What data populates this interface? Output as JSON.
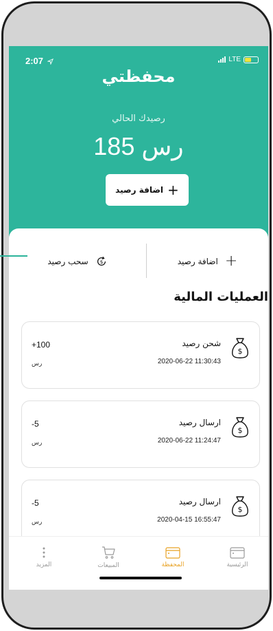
{
  "status": {
    "time": "2:07",
    "network": "LTE"
  },
  "header": {
    "title": "محفظتي",
    "balance_label": "رصيدك الحالي",
    "balance_amount": "185 رس",
    "add_button": "اضافة رصيد"
  },
  "actions": {
    "add": "اضافة رصيد",
    "withdraw": "سحب رصيد"
  },
  "section_title": "العمليات المالية",
  "transactions": [
    {
      "title": "شحن رصيد",
      "date": "2020-06-22 11:30:43",
      "amount": "+100",
      "currency": "رس"
    },
    {
      "title": "ارسال رصيد",
      "date": "2020-06-22 11:24:47",
      "amount": "-5",
      "currency": "رس"
    },
    {
      "title": "ارسال رصيد",
      "date": "2020-04-15 16:55:47",
      "amount": "-5",
      "currency": "رس"
    }
  ],
  "tabs": [
    {
      "label": "الرئيسية",
      "icon": "wallet-icon"
    },
    {
      "label": "المحفظة",
      "icon": "wallet-icon",
      "active": true
    },
    {
      "label": "المبيعات",
      "icon": "cart-icon"
    },
    {
      "label": "المزيد",
      "icon": "more-icon"
    }
  ],
  "colors": {
    "brand": "#2db59c",
    "active_tab": "#e8a224"
  }
}
